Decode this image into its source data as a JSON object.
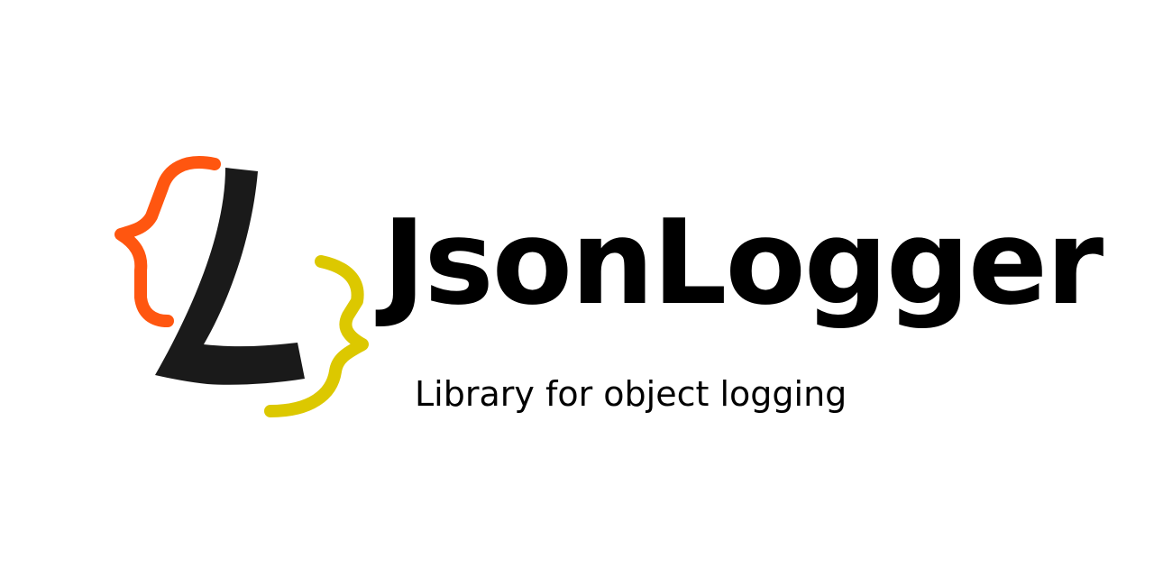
{
  "brand": {
    "name": "JsonLogger",
    "tagline": "Library for object logging"
  },
  "logo": {
    "icon": "braces-l-logo-icon",
    "colors": {
      "left_brace": "#ff5610",
      "letter": "#1a1a1a",
      "right_brace": "#dcc800"
    }
  },
  "colors": {
    "background": "#ffffff",
    "text": "#000000"
  }
}
